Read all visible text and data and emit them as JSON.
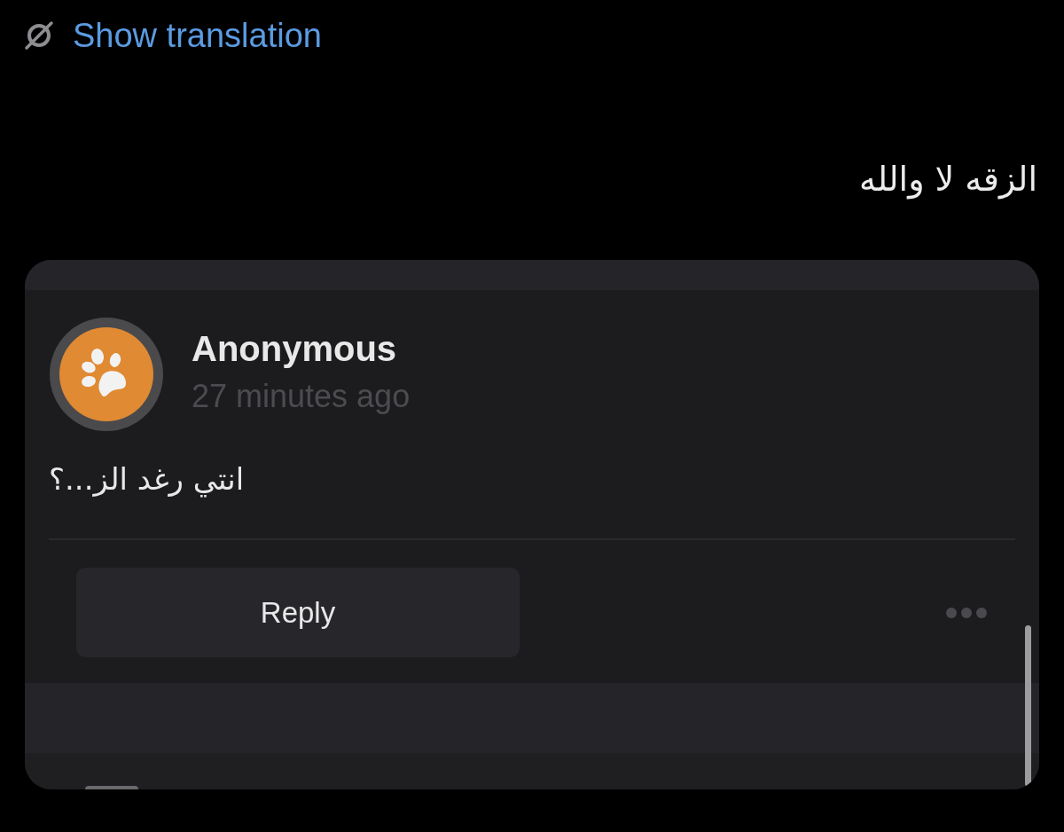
{
  "translation_link": {
    "label": "Show translation"
  },
  "post": {
    "text": "الزقه لا والله"
  },
  "comment": {
    "author": "Anonymous",
    "time": "27 minutes ago",
    "text": "انتي رغد الز...؟",
    "reply_button": "Reply"
  }
}
